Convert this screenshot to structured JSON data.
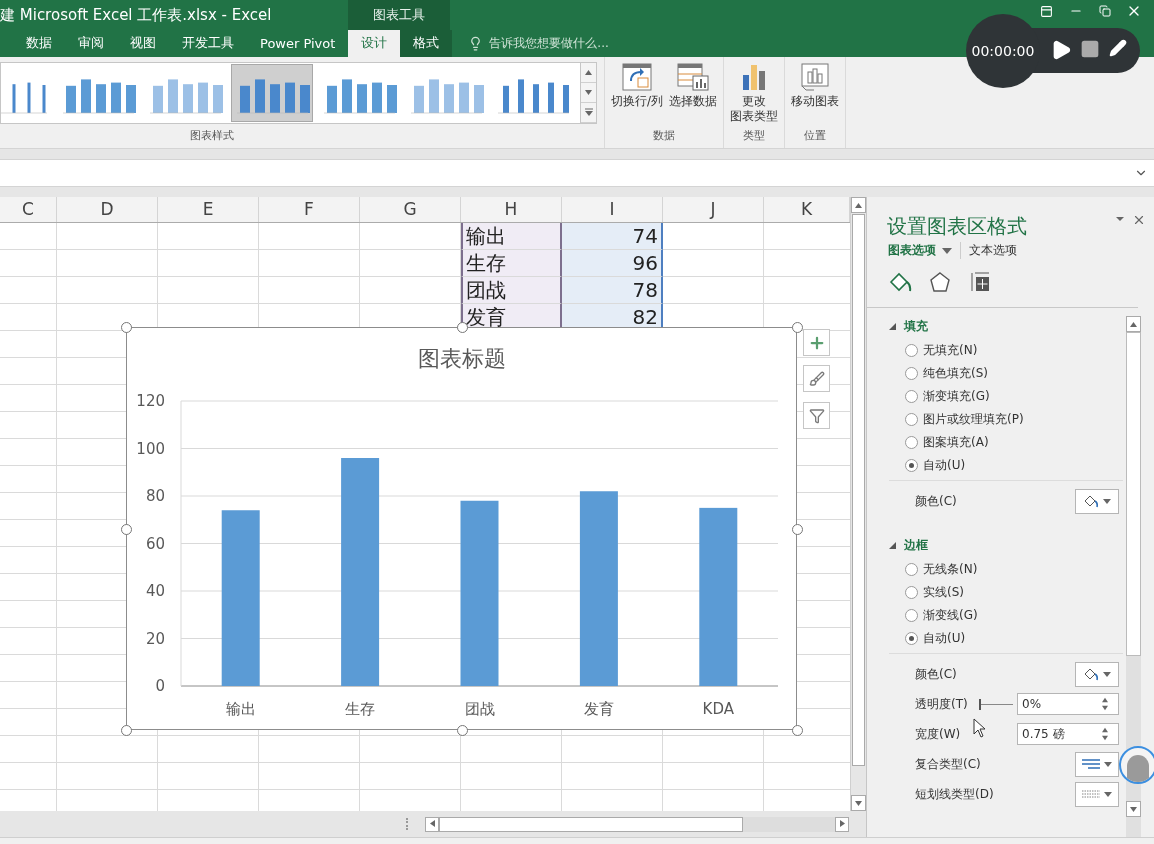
{
  "title_bar": {
    "title": "建 Microsoft Excel 工作表.xlsx - Excel",
    "context_label": "图表工具"
  },
  "ribbon_tabs": [
    {
      "label": "数据",
      "selected": false,
      "contextual": false
    },
    {
      "label": "审阅",
      "selected": false,
      "contextual": false
    },
    {
      "label": "视图",
      "selected": false,
      "contextual": false
    },
    {
      "label": "开发工具",
      "selected": false,
      "contextual": false
    },
    {
      "label": "Power Pivot",
      "selected": false,
      "contextual": false
    },
    {
      "label": "设计",
      "selected": true,
      "contextual": true
    },
    {
      "label": "格式",
      "selected": false,
      "contextual": true
    }
  ],
  "tell_me": {
    "placeholder": "告诉我您想要做什么..."
  },
  "recorder": {
    "time": "00:00:00"
  },
  "chart_styles": {
    "label": "图表样式",
    "styles": [
      {
        "selected": false
      },
      {
        "selected": false
      },
      {
        "selected": false
      },
      {
        "selected": true
      },
      {
        "selected": false
      },
      {
        "selected": false
      },
      {
        "selected": false
      }
    ]
  },
  "ribbon_groups": [
    {
      "label": "数据",
      "buttons": [
        {
          "kind": "switch",
          "lines": [
            "切换行/列"
          ]
        },
        {
          "kind": "select",
          "lines": [
            "选择数据"
          ]
        }
      ]
    },
    {
      "label": "类型",
      "buttons": [
        {
          "kind": "chart-type",
          "lines": [
            "更改",
            "图表类型"
          ]
        }
      ]
    },
    {
      "label": "位置",
      "buttons": [
        {
          "kind": "move",
          "lines": [
            "移动图表"
          ]
        }
      ]
    }
  ],
  "sheet": {
    "columns": [
      "C",
      "D",
      "E",
      "F",
      "G",
      "H",
      "I",
      "J",
      "K"
    ],
    "rows": [
      {
        "label": "输出",
        "value": "74"
      },
      {
        "label": "生存",
        "value": "96"
      },
      {
        "label": "团战",
        "value": "78"
      },
      {
        "label": "发育",
        "value": "82"
      }
    ]
  },
  "chart": {
    "title": "图表标题",
    "chart_data": {
      "type": "bar",
      "grid": true,
      "categories": [
        "输出",
        "生存",
        "团战",
        "发育",
        "KDA"
      ],
      "values": [
        74,
        96,
        78,
        82,
        75
      ],
      "ylim": [
        0,
        120
      ],
      "yticks": [
        0,
        20,
        40,
        60,
        80,
        100,
        120
      ]
    }
  },
  "format_pane": {
    "title": "设置图表区格式",
    "option_tabs": [
      {
        "label": "图表选项",
        "selected": true
      },
      {
        "label": "文本选项",
        "selected": false
      }
    ],
    "icon_tabs": [
      {
        "kind": "fill",
        "selected": true
      },
      {
        "kind": "effects",
        "selected": false
      },
      {
        "kind": "size",
        "selected": false
      }
    ],
    "sections": [
      {
        "title": "填充",
        "expanded": true,
        "options": [
          {
            "label": "无填充(N)",
            "selected": false
          },
          {
            "label": "纯色填充(S)",
            "selected": false
          },
          {
            "label": "渐变填充(G)",
            "selected": false
          },
          {
            "label": "图片或纹理填充(P)",
            "selected": false
          },
          {
            "label": "图案填充(A)",
            "selected": false
          },
          {
            "label": "自动(U)",
            "selected": true
          }
        ],
        "settings": [
          {
            "kind": "color",
            "label": "颜色(C)"
          }
        ]
      },
      {
        "title": "边框",
        "expanded": true,
        "options": [
          {
            "label": "无线条(N)",
            "selected": false
          },
          {
            "label": "实线(S)",
            "selected": false
          },
          {
            "label": "渐变线(G)",
            "selected": false
          },
          {
            "label": "自动(U)",
            "selected": true
          }
        ],
        "settings": [
          {
            "kind": "color",
            "label": "颜色(C)"
          },
          {
            "kind": "slider",
            "label": "透明度(T)",
            "level": 0,
            "value": "0%"
          },
          {
            "kind": "spin",
            "label": "宽度(W)",
            "value": "0.75 磅"
          },
          {
            "kind": "compound",
            "label": "复合类型(C)"
          },
          {
            "kind": "dash",
            "label": "短划线类型(D)"
          }
        ]
      }
    ]
  }
}
